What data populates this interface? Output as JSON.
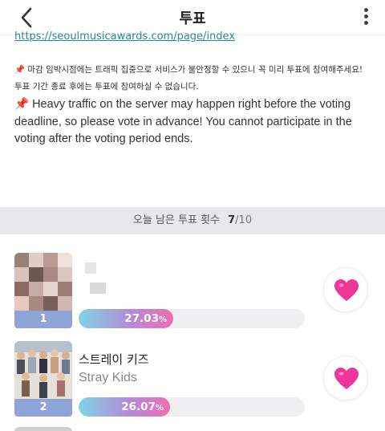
{
  "header": {
    "title": "투표",
    "back_icon": "chevron-left-icon",
    "more_icon": "vertical-dots-icon"
  },
  "content": {
    "url": "https://seoulmusicawards.com/page/index",
    "notice_ko_line1": "📌 마감 임박시점에는 트래픽 집중으로 서비스가 불안정할 수 있으니 꼭 미리 투표에 참여해주세요!",
    "notice_ko_line2": "투표 기간 종료 후에는 투표에 참여하실 수 없습니다.",
    "notice_en": "📌 Heavy traffic on the server may happen right before the voting deadline, so please vote in advance! You cannot participate in the voting after the voting period ends."
  },
  "counter": {
    "label": "오늘 남은 투표 횟수",
    "remaining": "7",
    "total": "/10"
  },
  "candidates": [
    {
      "rank": "1",
      "name_ko": "",
      "name_en": "",
      "percent_value": 27.03,
      "percent": "27.03",
      "percent_sign": "%",
      "heart_icon": "heart-icon",
      "colors": {
        "thumb_a": "#8a6a62",
        "thumb_b": "#e8c8c0"
      }
    },
    {
      "rank": "2",
      "name_ko": "스트레이 키즈",
      "name_en": "Stray Kids",
      "percent_value": 26.07,
      "percent": "26.07",
      "percent_sign": "%",
      "heart_icon": "heart-icon",
      "colors": {
        "thumb_a": "#c9a07f",
        "thumb_b": "#6a7c95"
      }
    }
  ],
  "colors": {
    "accent_link": "#2a8b8b",
    "rank_badge": "#8ea3d6",
    "heart": "#f0359a",
    "bar_gradient_start": "#7fd4e6",
    "bar_gradient_end": "#ee6fb0"
  }
}
